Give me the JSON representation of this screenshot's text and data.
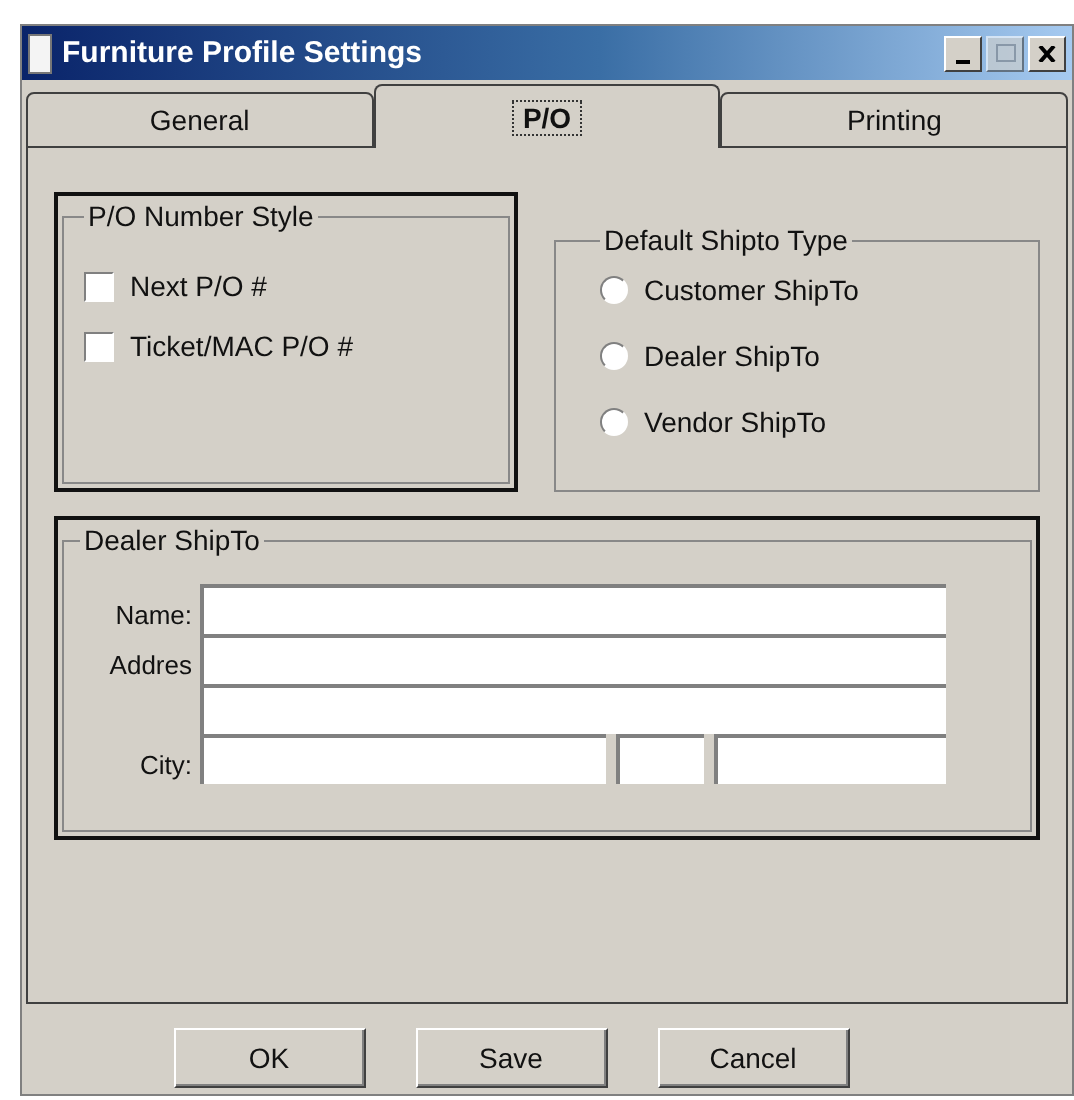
{
  "window": {
    "title": "Furniture Profile Settings"
  },
  "tabs": [
    {
      "label": "General",
      "selected": false
    },
    {
      "label": "P/O",
      "selected": true
    },
    {
      "label": "Printing",
      "selected": false
    }
  ],
  "po_number_style": {
    "title": "P/O Number Style",
    "options": [
      {
        "label": "Next P/O #",
        "checked": false
      },
      {
        "label": "Ticket/MAC P/O #",
        "checked": false
      }
    ]
  },
  "default_shipto_type": {
    "title": "Default Shipto Type",
    "options": [
      {
        "label": "Customer ShipTo",
        "selected": false
      },
      {
        "label": "Dealer ShipTo",
        "selected": false
      },
      {
        "label": "Vendor ShipTo",
        "selected": false
      }
    ]
  },
  "dealer_shipto": {
    "title": "Dealer ShipTo",
    "rows": [
      {
        "kind": "single",
        "label": "Name:"
      },
      {
        "kind": "single",
        "label": "Addres"
      },
      {
        "kind": "single"
      },
      {
        "kind": "city",
        "label": "City:"
      }
    ]
  },
  "buttons": [
    "OK",
    "Save",
    "Cancel"
  ]
}
